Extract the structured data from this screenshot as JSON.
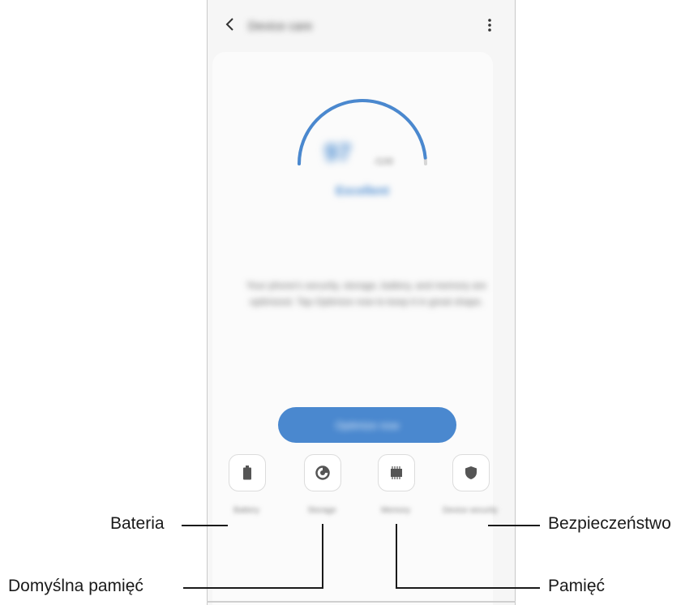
{
  "app": {
    "title": "Device care",
    "score": "97",
    "score_unit": "/100",
    "status": "Excellent",
    "description": "Your phone's security, storage, battery, and memory are optimized. Tap Optimize now to keep it in great shape.",
    "optimize_label": "Optimize now",
    "score_fraction": 0.97
  },
  "tiles": [
    {
      "label": "Battery",
      "icon": "battery-icon"
    },
    {
      "label": "Storage",
      "icon": "storage-pie-icon"
    },
    {
      "label": "Memory",
      "icon": "memory-chip-icon"
    },
    {
      "label": "Device security",
      "icon": "shield-icon"
    }
  ],
  "callouts": {
    "bateria": "Bateria",
    "domyslna_pamiec": "Domyślna pamięć",
    "pamiec": "Pamięć",
    "bezpieczenstwo": "Bezpieczeństwo"
  },
  "colors": {
    "accent": "#4a88cf",
    "gauge_track": "#d6d6d6",
    "background": "#f6f6f6"
  }
}
